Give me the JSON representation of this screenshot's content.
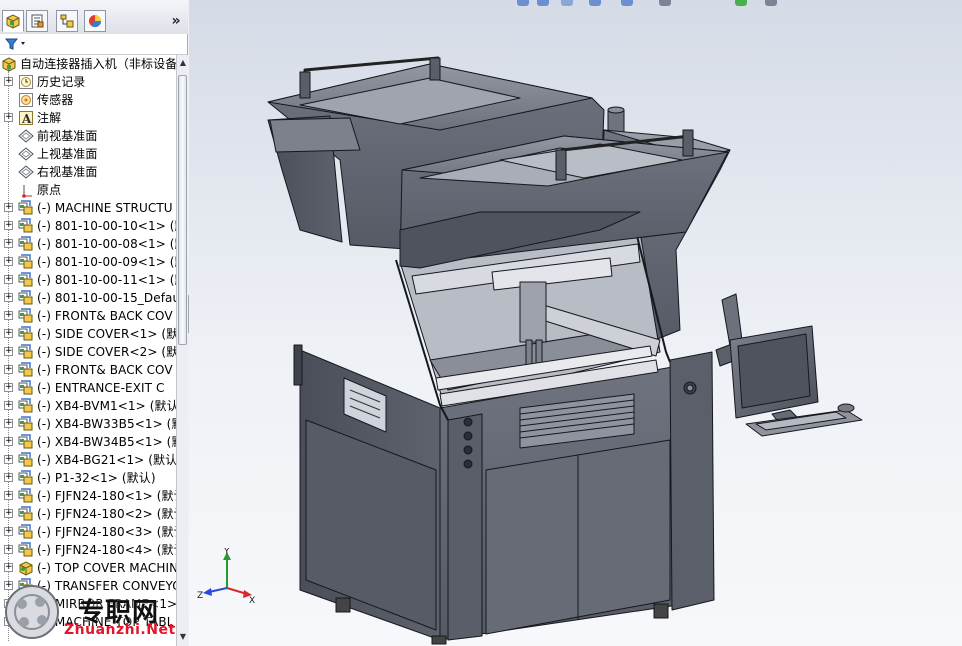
{
  "tabs": [
    {
      "name": "feature-manager"
    },
    {
      "name": "property-manager"
    },
    {
      "name": "configuration-manager"
    },
    {
      "name": "display-manager"
    }
  ],
  "tabs_more": "»",
  "filter": {
    "icon": "filter-icon"
  },
  "tree": {
    "root": "自动连接器插入机（非标设备",
    "items": [
      {
        "label": "历史记录",
        "icon": "history-icon"
      },
      {
        "label": "传感器",
        "icon": "sensor-icon"
      },
      {
        "label": "注解",
        "icon": "annotation-icon"
      },
      {
        "label": "前视基准面",
        "icon": "plane-icon"
      },
      {
        "label": "上视基准面",
        "icon": "plane-icon"
      },
      {
        "label": "右视基准面",
        "icon": "plane-icon"
      },
      {
        "label": "原点",
        "icon": "origin-icon"
      },
      {
        "label": "(-) MACHINE STRUCTU",
        "icon": "subassembly-icon"
      },
      {
        "label": "(-) 801-10-00-10<1> (默",
        "icon": "subassembly-icon"
      },
      {
        "label": "(-) 801-10-00-08<1> (默",
        "icon": "subassembly-icon"
      },
      {
        "label": "(-) 801-10-00-09<1> (默",
        "icon": "subassembly-icon"
      },
      {
        "label": "(-) 801-10-00-11<1> (默",
        "icon": "subassembly-icon"
      },
      {
        "label": "(-) 801-10-00-15_Defau",
        "icon": "subassembly-icon"
      },
      {
        "label": "(-) FRONT& BACK COV",
        "icon": "subassembly-icon"
      },
      {
        "label": "(-) SIDE COVER<1> (默",
        "icon": "subassembly-icon"
      },
      {
        "label": "(-) SIDE COVER<2> (默",
        "icon": "subassembly-icon"
      },
      {
        "label": "(-) FRONT& BACK COV",
        "icon": "subassembly-icon"
      },
      {
        "label": "(-) ENTRANCE-EXIT  C",
        "icon": "subassembly-icon"
      },
      {
        "label": "(-) XB4-BVM1<1> (默认",
        "icon": "subassembly-icon"
      },
      {
        "label": "(-) XB4-BW33B5<1> (默",
        "icon": "subassembly-icon"
      },
      {
        "label": "(-) XB4-BW34B5<1> (默",
        "icon": "subassembly-icon"
      },
      {
        "label": "(-) XB4-BG21<1> (默认",
        "icon": "subassembly-icon"
      },
      {
        "label": "(-) P1-32<1> (默认)",
        "icon": "subassembly-icon"
      },
      {
        "label": "(-) FJFN24-180<1> (默认",
        "icon": "subassembly-icon"
      },
      {
        "label": "(-) FJFN24-180<2> (默认",
        "icon": "subassembly-icon"
      },
      {
        "label": "(-) FJFN24-180<3> (默认",
        "icon": "subassembly-icon"
      },
      {
        "label": "(-) FJFN24-180<4> (默认",
        "icon": "subassembly-icon"
      },
      {
        "label": "(-) TOP COVER MACHIN",
        "icon": "part-icon"
      },
      {
        "label": "(-) TRANSFER CONVEYO",
        "icon": "subassembly-icon"
      },
      {
        "label": "(-) MIRROR FRAME<1>",
        "icon": "subassembly-icon"
      },
      {
        "label": "(-) MACHINE TOP TABL",
        "icon": "subassembly-icon"
      }
    ]
  },
  "scrollbar": {
    "up": "▲",
    "down": "▼"
  },
  "splitter": {
    "arrow": "◂"
  },
  "triad": {
    "x": "X",
    "y": "Y",
    "z": "Z"
  },
  "watermark": {
    "text_cn": "专职网",
    "text_en": "Zhuanzhi.Net"
  },
  "colors": {
    "model_face": "#5f6470",
    "model_light": "#8d929e",
    "model_dark": "#3c4049",
    "model_edge": "#16181d",
    "selection_blue": "#316ac5"
  }
}
